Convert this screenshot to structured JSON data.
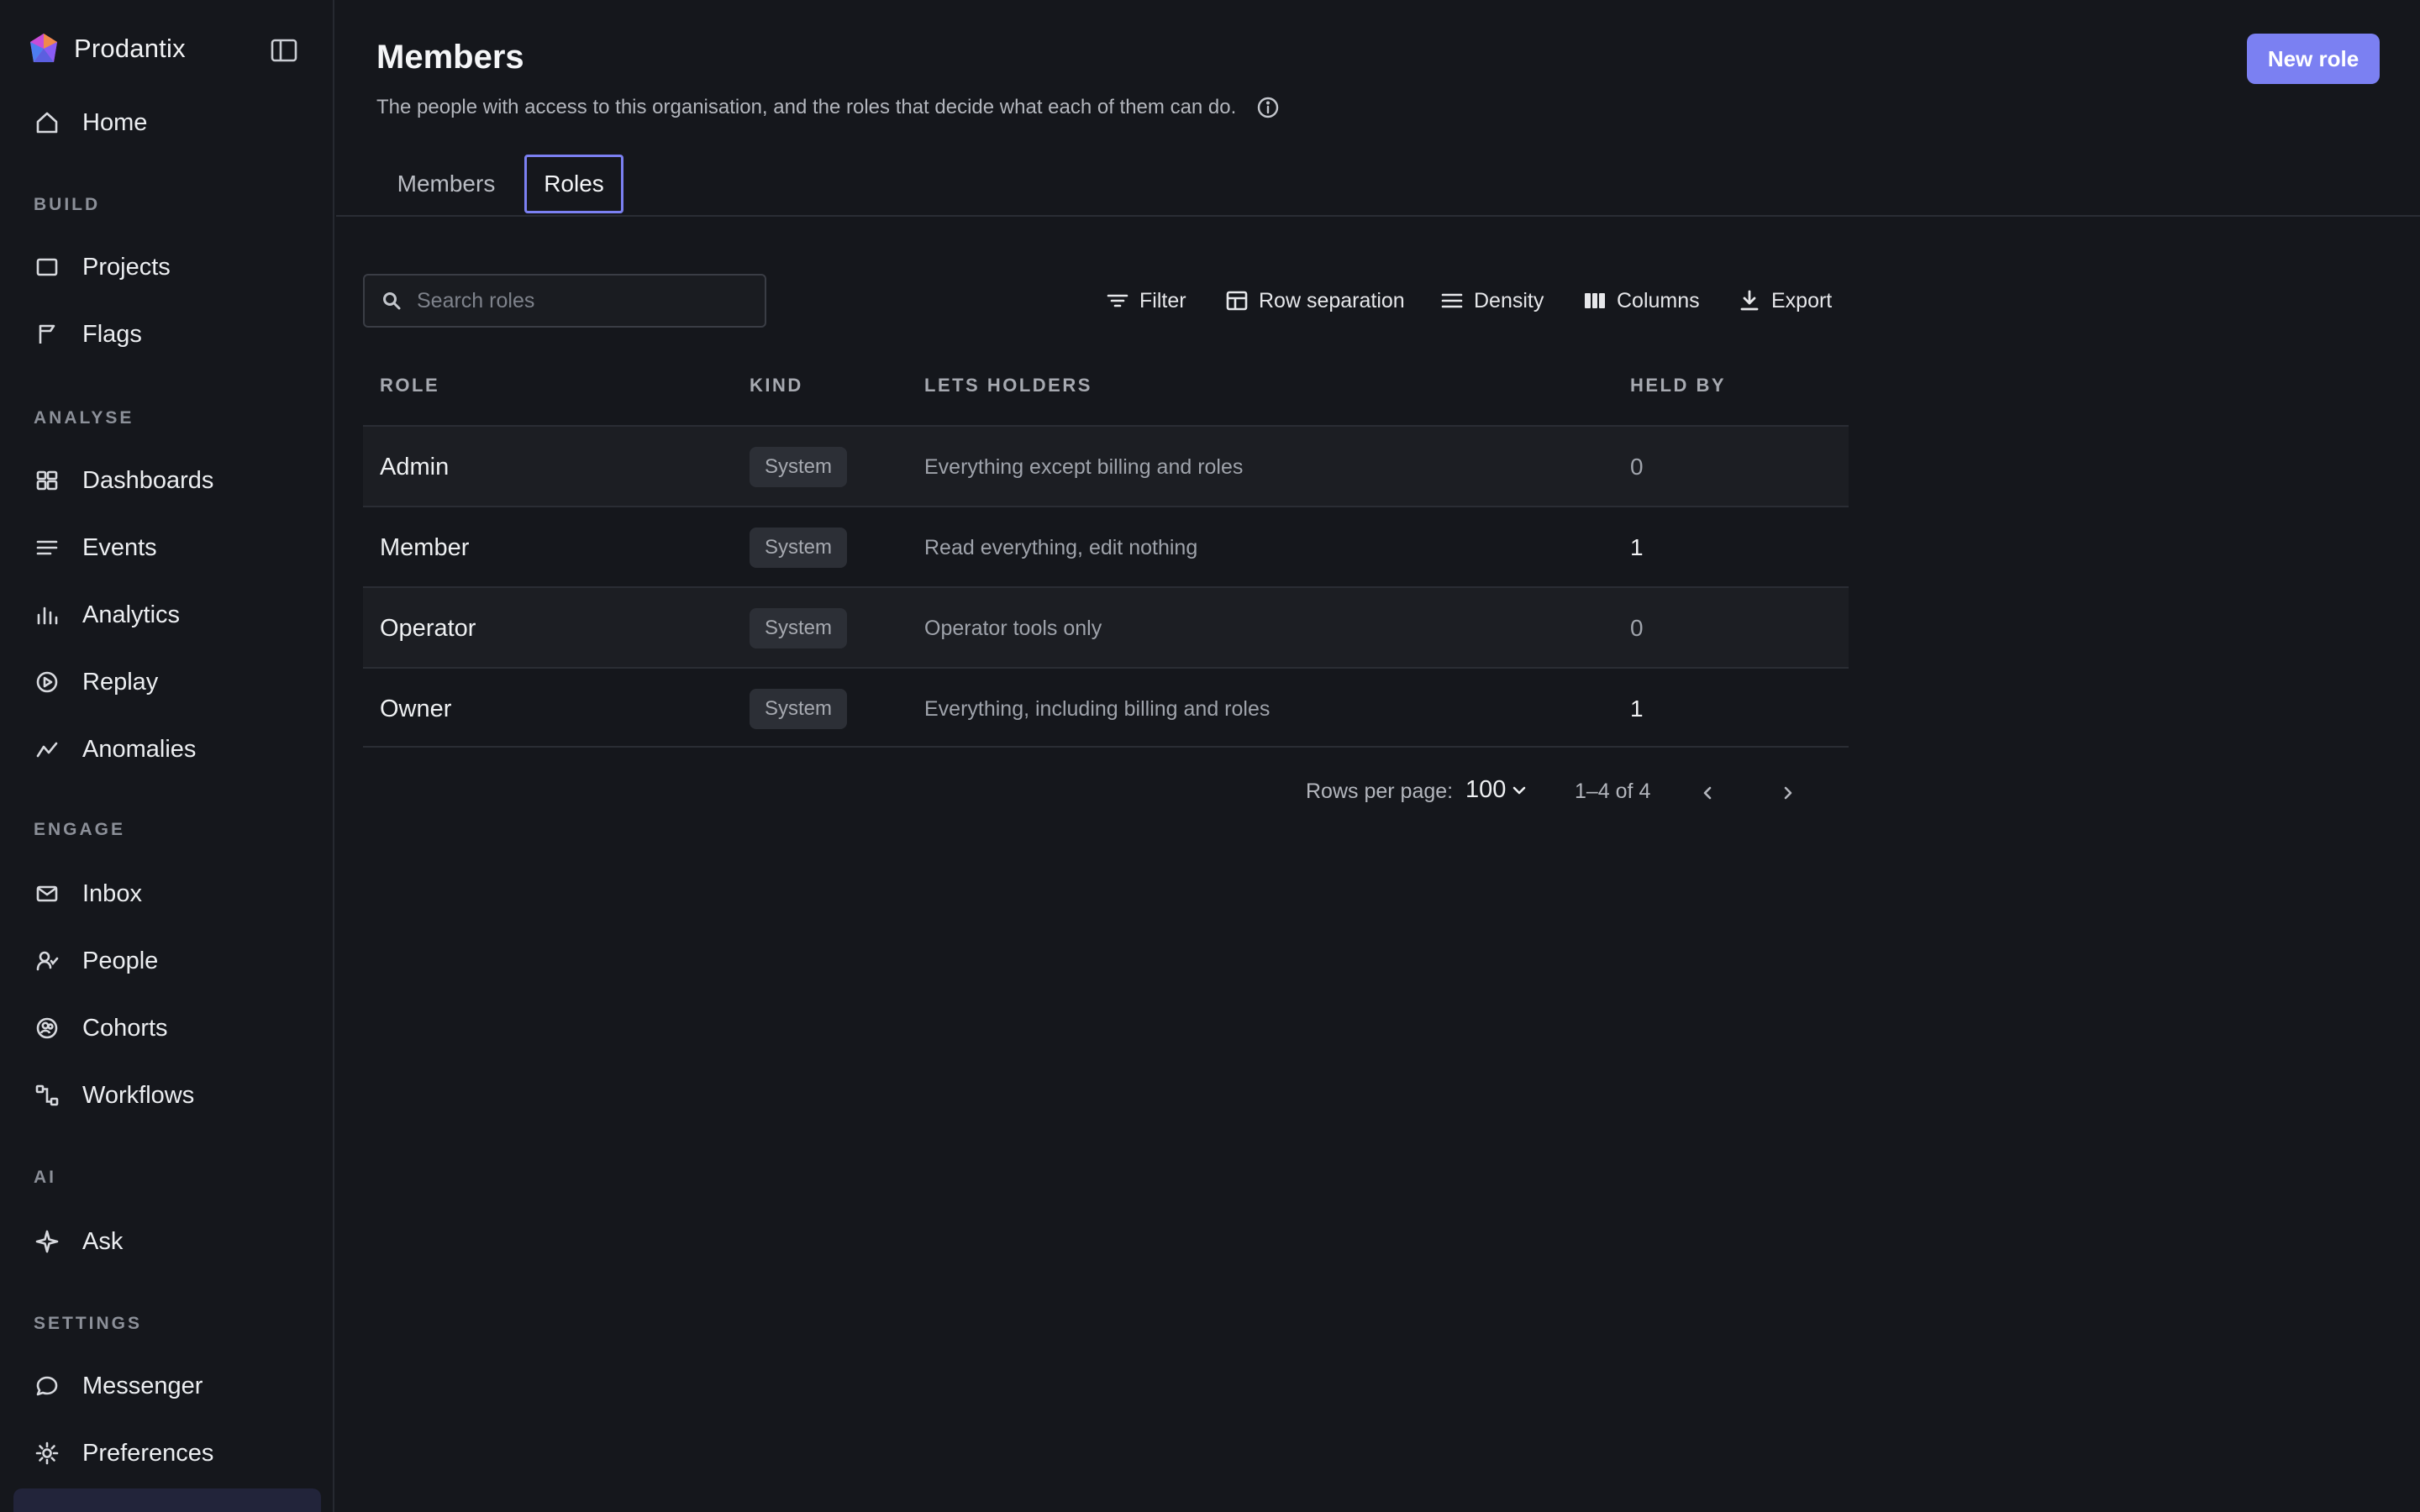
{
  "app": {
    "name": "Prodantix"
  },
  "sidebar": {
    "home": "Home",
    "sections": [
      {
        "label": "BUILD",
        "items": [
          "Projects",
          "Flags"
        ]
      },
      {
        "label": "ANALYSE",
        "items": [
          "Dashboards",
          "Events",
          "Analytics",
          "Replay",
          "Anomalies"
        ]
      },
      {
        "label": "ENGAGE",
        "items": [
          "Inbox",
          "People",
          "Cohorts",
          "Workflows"
        ]
      },
      {
        "label": "AI",
        "items": [
          "Ask"
        ]
      },
      {
        "label": "SETTINGS",
        "items": [
          "Messenger",
          "Preferences"
        ]
      }
    ]
  },
  "header": {
    "title": "Members",
    "subtitle": "The people with access to this organisation, and the roles that decide what each of them can do.",
    "new_role_label": "New role"
  },
  "tabs": [
    {
      "label": "Members",
      "active": false
    },
    {
      "label": "Roles",
      "active": true
    }
  ],
  "toolbar": {
    "search_placeholder": "Search roles",
    "search_value": "",
    "filter": "Filter",
    "row_separation": "Row separation",
    "density": "Density",
    "columns": "Columns",
    "export": "Export"
  },
  "table": {
    "columns": [
      "ROLE",
      "KIND",
      "LETS HOLDERS",
      "HELD BY"
    ],
    "rows": [
      {
        "role": "Admin",
        "kind": "System",
        "lets_holders": "Everything except billing and roles",
        "held_by": "0"
      },
      {
        "role": "Member",
        "kind": "System",
        "lets_holders": "Read everything, edit nothing",
        "held_by": "1"
      },
      {
        "role": "Operator",
        "kind": "System",
        "lets_holders": "Operator tools only",
        "held_by": "0"
      },
      {
        "role": "Owner",
        "kind": "System",
        "lets_holders": "Everything, including billing and roles",
        "held_by": "1"
      }
    ]
  },
  "pagination": {
    "rows_per_page_label": "Rows per page:",
    "rows_per_page_value": "100",
    "range": "1–4 of 4"
  },
  "colors": {
    "background": "#15171c",
    "accent": "#7b80f2",
    "chip_bg": "#2c2f36"
  }
}
